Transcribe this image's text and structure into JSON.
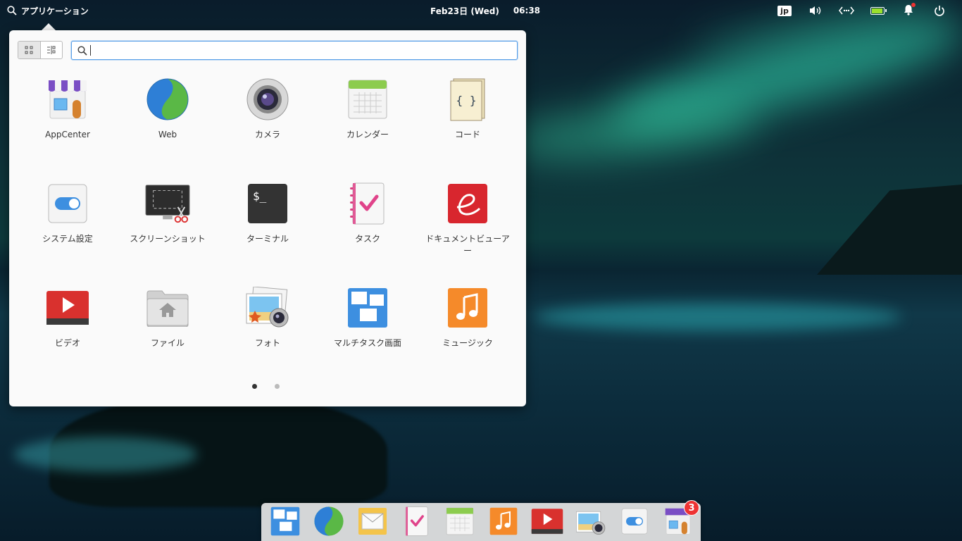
{
  "panel": {
    "app_menu_label": "アプリケーション",
    "date": "Feb23日 (Wed)",
    "time": "06:38",
    "keyboard_layout": "jp",
    "indicators": [
      "keyboard-icon",
      "volume-icon",
      "network-icon",
      "battery-icon",
      "notifications-icon",
      "power-icon"
    ]
  },
  "app_menu": {
    "search": {
      "value": "",
      "placeholder": ""
    },
    "view_modes": [
      "grid-view-icon",
      "category-view-icon"
    ],
    "apps": [
      {
        "label": "AppCenter",
        "icon": "appcenter-icon"
      },
      {
        "label": "Web",
        "icon": "web-browser-icon"
      },
      {
        "label": "カメラ",
        "icon": "camera-icon"
      },
      {
        "label": "カレンダー",
        "icon": "calendar-icon"
      },
      {
        "label": "コード",
        "icon": "code-editor-icon"
      },
      {
        "label": "システム設定",
        "icon": "system-settings-icon"
      },
      {
        "label": "スクリーンショット",
        "icon": "screenshot-icon"
      },
      {
        "label": "ターミナル",
        "icon": "terminal-icon"
      },
      {
        "label": "タスク",
        "icon": "tasks-icon"
      },
      {
        "label": "ドキュメントビューアー",
        "icon": "document-viewer-icon"
      },
      {
        "label": "ビデオ",
        "icon": "videos-icon"
      },
      {
        "label": "ファイル",
        "icon": "files-icon"
      },
      {
        "label": "フォト",
        "icon": "photos-icon"
      },
      {
        "label": "マルチタスク画面",
        "icon": "multitasking-icon"
      },
      {
        "label": "ミュージック",
        "icon": "music-icon"
      }
    ],
    "pages": {
      "count": 2,
      "current": 1
    }
  },
  "dock": {
    "items": [
      "multitasking-icon",
      "web-browser-icon",
      "mail-icon",
      "tasks-icon",
      "calendar-icon",
      "music-icon",
      "videos-icon",
      "photos-icon",
      "system-settings-icon",
      "appcenter-icon"
    ],
    "appcenter_badge": "3"
  },
  "colors": {
    "accent": "#5aa0e8",
    "popover_bg": "#fafafa"
  }
}
